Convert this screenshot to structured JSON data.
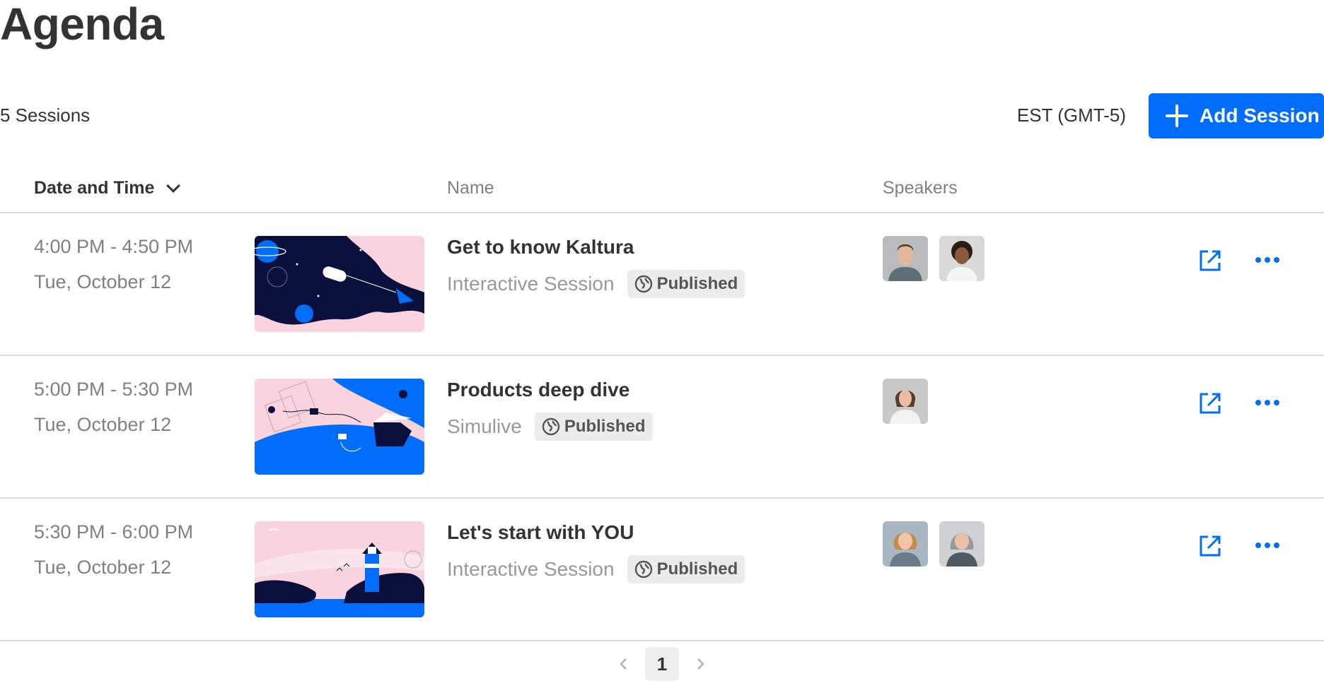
{
  "page": {
    "title": "Agenda"
  },
  "toolbar": {
    "session_count": "5 Sessions",
    "timezone": "EST (GMT-5)",
    "add_session_label": "Add Session"
  },
  "table": {
    "headers": {
      "date_time": "Date and Time",
      "name": "Name",
      "speakers": "Speakers"
    },
    "rows": [
      {
        "time": "4:00 PM - 4:50 PM",
        "date": "Tue, October 12",
        "name": "Get to know Kaltura",
        "type": "Interactive Session",
        "status": "Published",
        "speaker_count": 2
      },
      {
        "time": "5:00 PM - 5:30 PM",
        "date": "Tue, October 12",
        "name": "Products deep dive",
        "type": "Simulive",
        "status": "Published",
        "speaker_count": 1
      },
      {
        "time": "5:30 PM - 6:00 PM",
        "date": "Tue, October 12",
        "name": "Let's start with YOU",
        "type": "Interactive Session",
        "status": "Published",
        "speaker_count": 2
      }
    ]
  },
  "pagination": {
    "current_page": "1"
  },
  "colors": {
    "accent": "#006EFA",
    "thumb_pink": "#F9D3DD",
    "thumb_navy": "#0A0F3C",
    "thumb_blue": "#006EFA"
  }
}
